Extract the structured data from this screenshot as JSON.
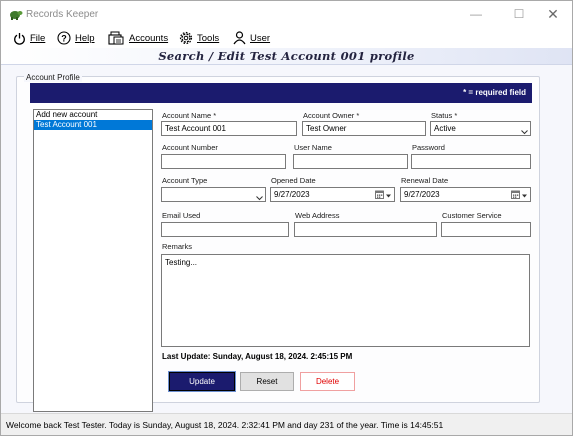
{
  "window": {
    "title": "Records Keeper"
  },
  "menu": {
    "file": "File",
    "help": "Help",
    "accounts": "Accounts",
    "tools": "Tools",
    "user": "User"
  },
  "header": {
    "title": "Search / Edit Test Account 001 profile"
  },
  "profile": {
    "group_title": "Account Profile",
    "required_note": "* = required field",
    "account_list": [
      "Add new account",
      "Test Account 001"
    ],
    "selected_account": "Test Account 001",
    "fields": {
      "account_name": {
        "label": "Account Name *",
        "value": "Test Account 001"
      },
      "account_owner": {
        "label": "Account Owner *",
        "value": "Test Owner"
      },
      "status": {
        "label": "Status *",
        "value": "Active"
      },
      "account_number": {
        "label": "Account Number",
        "value": ""
      },
      "user_name": {
        "label": "User Name",
        "value": ""
      },
      "password": {
        "label": "Password",
        "value": ""
      },
      "account_type": {
        "label": "Account Type",
        "value": ""
      },
      "opened_date": {
        "label": "Opened Date",
        "value": "9/27/2023"
      },
      "renewal_date": {
        "label": "Renewal Date",
        "value": "9/27/2023"
      },
      "email_used": {
        "label": "Email Used",
        "value": ""
      },
      "web_address": {
        "label": "Web Address",
        "value": ""
      },
      "customer_service": {
        "label": "Customer Service",
        "value": ""
      },
      "remarks": {
        "label": "Remarks",
        "value": "Testing..."
      }
    },
    "last_update": "Last Update: Sunday, August 18, 2024. 2:45:15 PM",
    "buttons": {
      "update": "Update",
      "reset": "Reset",
      "delete": "Delete"
    }
  },
  "status_bar": {
    "text": "Welcome back Test Tester.   Today is Sunday, August 18, 2024. 2:32:41 PM and day 231 of the year.   Time is 14:45:51"
  },
  "colors": {
    "accent_navy": "#1b1b6e",
    "selection_blue": "#0078d7",
    "delete_red": "#e00000"
  }
}
